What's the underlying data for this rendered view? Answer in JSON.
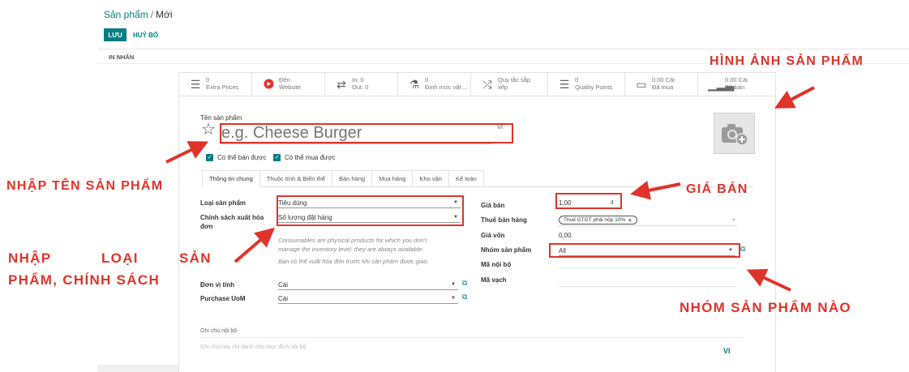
{
  "header": {
    "breadcrumb_root": "Sản phẩm",
    "breadcrumb_separator": "/",
    "breadcrumb_current": "Mới",
    "save_label": "LƯU",
    "discard_label": "HUỶ BỎ",
    "print_label": "IN NHÃN"
  },
  "stats": [
    {
      "icon": "list-icon",
      "line1": "0",
      "line2": "Extra Prices"
    },
    {
      "icon": "globe-icon",
      "line1": "Đến",
      "line2": "Website"
    },
    {
      "icon": "transfer-icon",
      "line1": "In:  0",
      "line2": "Out:  0"
    },
    {
      "icon": "flask-icon",
      "line1": "0",
      "line2": "Định mức vật ..."
    },
    {
      "icon": "shuffle-icon",
      "line1": "Quy tắc sắp",
      "line2": "xếp"
    },
    {
      "icon": "list-icon",
      "line1": "0",
      "line2": "Quality Points"
    },
    {
      "icon": "card-icon",
      "line1": "0,00 Cái",
      "line2": "Đã mua"
    },
    {
      "icon": "bar-chart-icon",
      "line1": "0,00 Cái",
      "line2": "Đã bán"
    }
  ],
  "product": {
    "name_label": "Tên sản phẩm",
    "name_placeholder": "e.g. Cheese Burger",
    "lang": "VI",
    "can_be_sold": "Có thể bán được",
    "can_be_purchased": "Có thể mua được"
  },
  "tabs": [
    "Thông tin chung",
    "Thuộc tính & Biến thể",
    "Bán hàng",
    "Mua hàng",
    "Kho vận",
    "Kế toán"
  ],
  "general": {
    "type_label": "Loại sản phẩm",
    "type_value": "Tiêu dùng",
    "invoice_policy_label_1": "Chính sách xuất hóa",
    "invoice_policy_label_2": "đơn",
    "invoice_policy_value": "Số lượng đặt hàng",
    "help_1": "Consumables are physical products for which you don't",
    "help_2": "manage the inventory level: they are always available.",
    "help_3": "Bạn có thể xuất hóa đơn trước khi sản phẩm được giao.",
    "uom_label": "Đơn vị tính",
    "uom_value": "Cái",
    "purchase_uom_label": "Purchase UoM",
    "purchase_uom_value": "Cái",
    "sale_price_label": "Giá bán",
    "sale_price_value": "1,00",
    "currency": "₫",
    "customer_tax_label": "Thuế bán hàng",
    "customer_tax_tag": "Thuế GTGT phải nộp 10%",
    "cost_label": "Giá vốn",
    "cost_value": "0,00",
    "category_label": "Nhóm sản phẩm",
    "category_value": "All",
    "internal_ref_label": "Mã nội bộ",
    "barcode_label": "Mã vạch",
    "internal_notes_label": "Ghi chú nội bộ",
    "internal_notes_placeholder": "Ghi chú này chỉ dành cho mục đích nội bộ.",
    "notes_lang": "VI"
  },
  "annotations": {
    "image": "HÌNH ẢNH SẢN PHẨM",
    "name": "NHẬP TÊN SẢN PHẨM",
    "price": "GIÁ BÁN",
    "type_line1_a": "NHẬP",
    "type_line1_b": "LOẠI",
    "type_line1_c": "SẢN",
    "type_line2": "PHẨM, CHÍNH SÁCH",
    "category": "NHÓM SẢN PHẨM NÀO",
    "accent_color": "#e0342b"
  },
  "colors": {
    "primary": "#017e84",
    "annotation": "#e0342b"
  }
}
